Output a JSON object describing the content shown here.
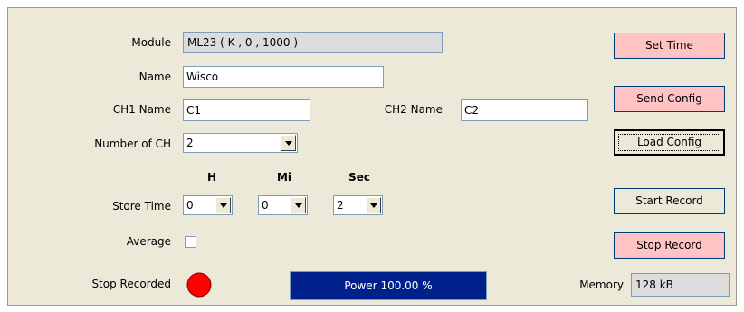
{
  "labels": {
    "module": "Module",
    "name": "Name",
    "ch1_name": "CH1 Name",
    "ch2_name": "CH2 Name",
    "number_of_ch": "Number of CH",
    "store_time": "Store Time",
    "average": "Average",
    "stop_recorded": "Stop Recorded",
    "memory": "Memory"
  },
  "fields": {
    "module_value": "ML23 ( K , 0 , 1000 )",
    "name_value": "Wisco",
    "ch1_value": "C1",
    "ch2_value": "C2",
    "number_of_ch_value": "2",
    "memory_value": "128 kB"
  },
  "store_time": {
    "headers": {
      "h": "H",
      "mi": "Mi",
      "sec": "Sec"
    },
    "h_value": "0",
    "mi_value": "0",
    "sec_value": "2"
  },
  "average_checked": false,
  "status": {
    "indicator_color": "#ff0000",
    "power_text": "Power  100.00 %",
    "power_color": "#00208b"
  },
  "buttons": {
    "set_time": "Set Time",
    "send_config": "Send Config",
    "load_config": "Load Config",
    "start_record": "Start Record",
    "stop_record": "Stop Record"
  },
  "colors": {
    "pink_button": "#ffc3c3",
    "panel_bg": "#ece9d8"
  }
}
